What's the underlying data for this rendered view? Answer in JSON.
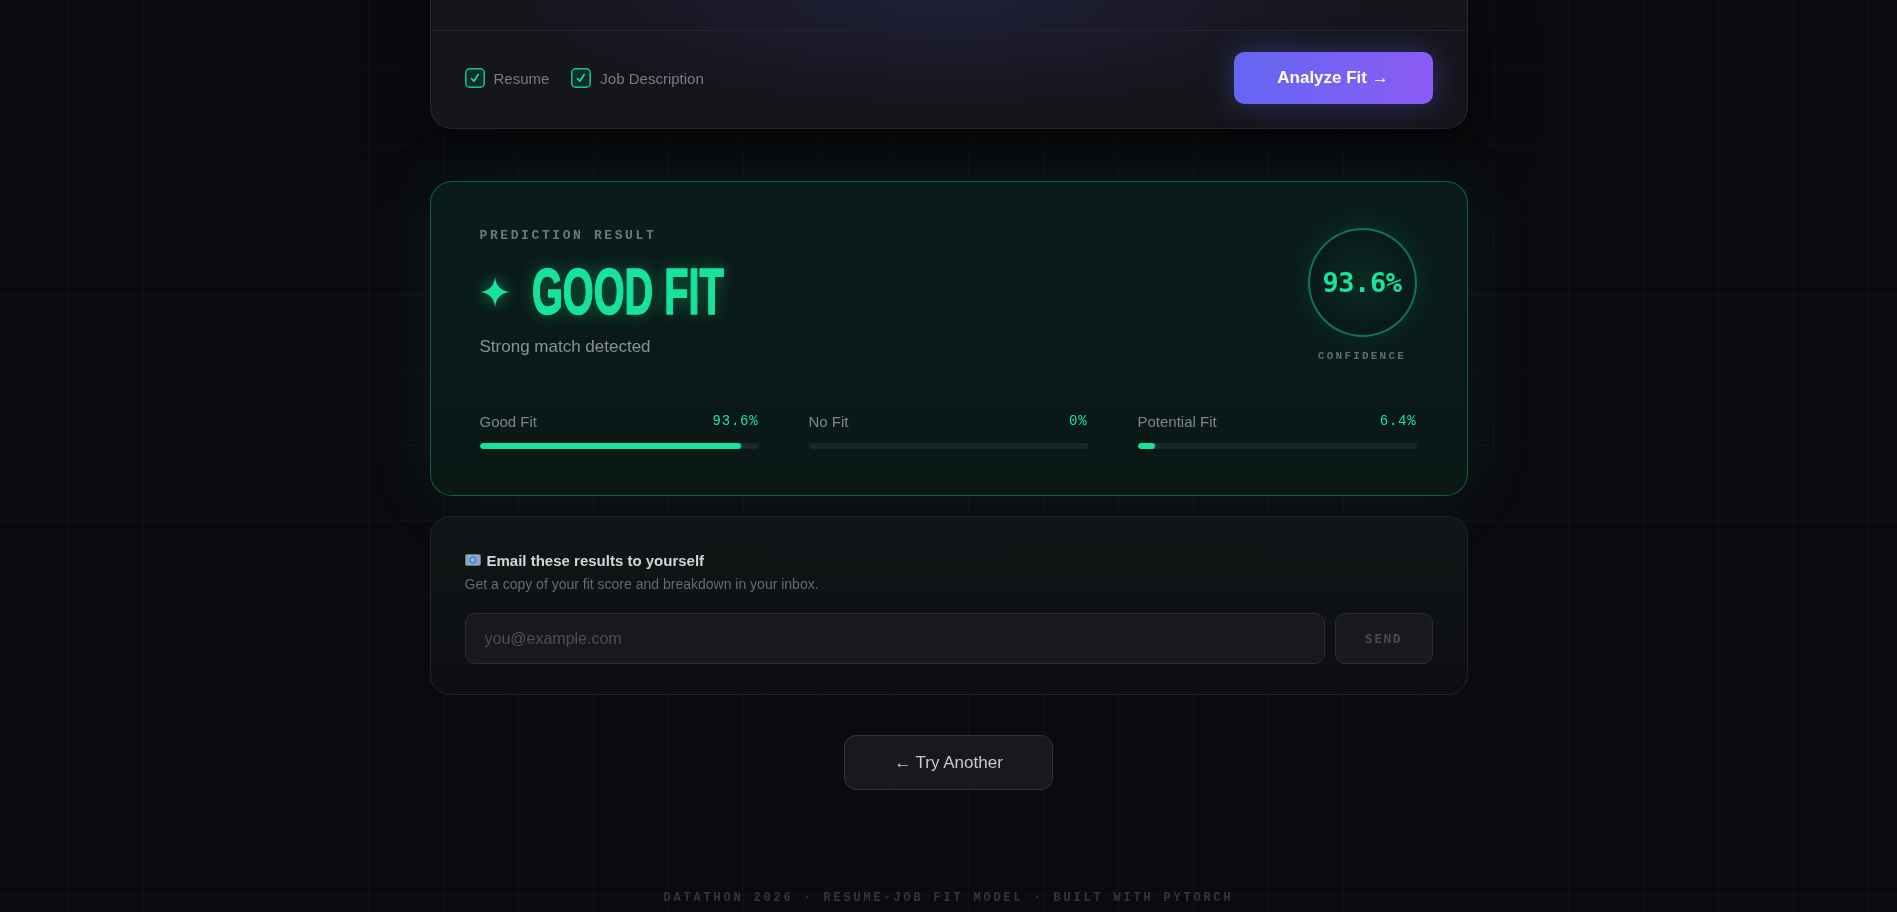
{
  "input_panel": {
    "sources": [
      {
        "label": "Resume",
        "checked": true
      },
      {
        "label": "Job Description",
        "checked": true
      }
    ],
    "analyze_button": "Analyze Fit →"
  },
  "result": {
    "eyebrow": "PREDICTION RESULT",
    "verdict": "GOOD FIT",
    "subtitle": "Strong match detected",
    "confidence": {
      "value": "93.6%",
      "label": "CONFIDENCE"
    },
    "classes": [
      {
        "label": "Good Fit",
        "reading": "93.6%",
        "level": 0.936
      },
      {
        "label": "No Fit",
        "reading": "0%"
      },
      {
        "label": "Potential Fit",
        "reading": "6.4%",
        "level": 0.064
      }
    ]
  },
  "email": {
    "title": "Email these results to yourself",
    "subtitle": "Get a copy of your fit score and breakdown in your inbox.",
    "input": {
      "placeholder": "you@example.com"
    },
    "send_button": {
      "label": "SEND",
      "disabled": true
    }
  },
  "try_another_button": "← Try Another",
  "footer": "DATATHON 2026 · RESUME-JOB FIT MODEL · BUILT WITH PYTORCH"
}
